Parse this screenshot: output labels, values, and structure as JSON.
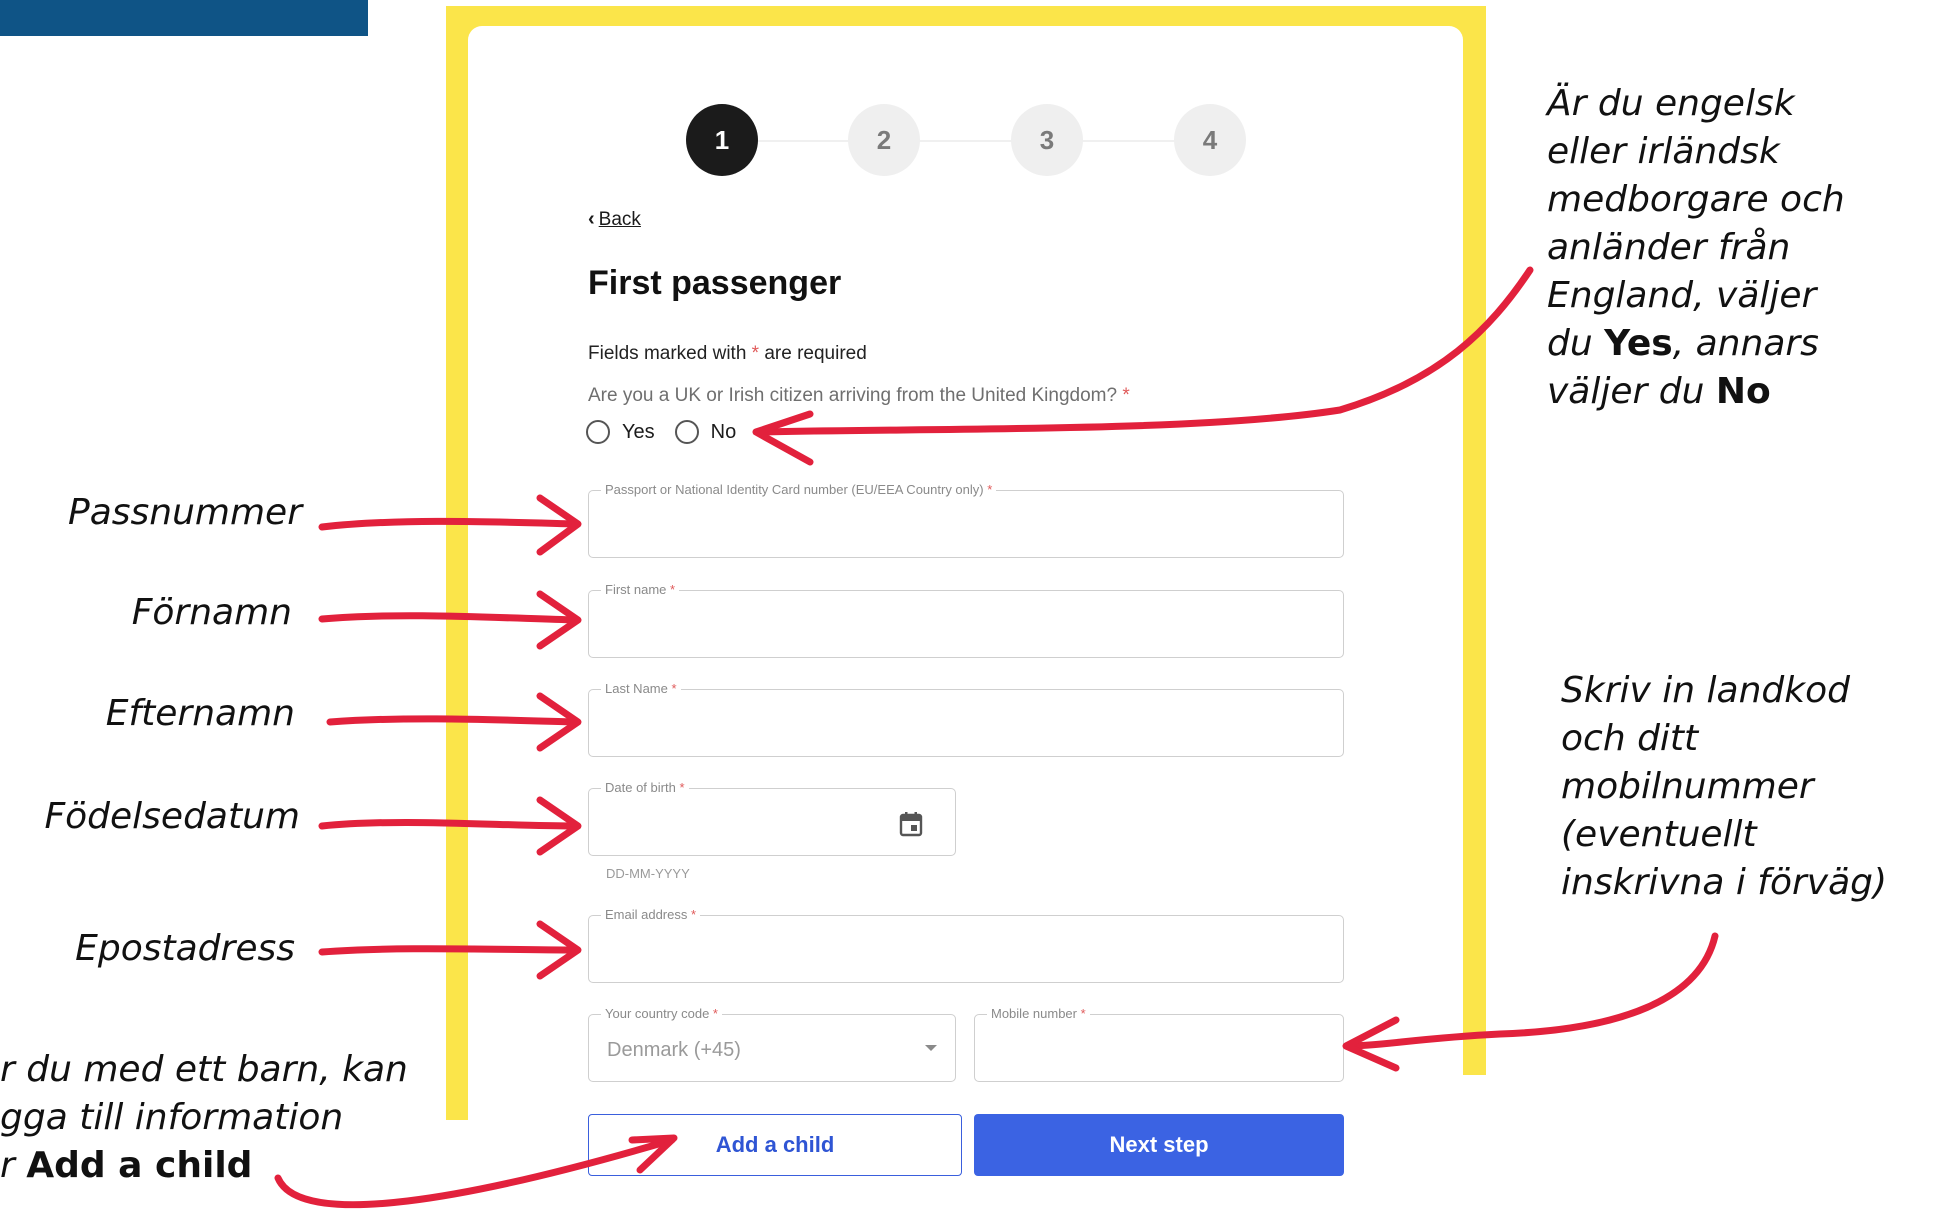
{
  "stepper": {
    "steps": [
      "1",
      "2",
      "3",
      "4"
    ],
    "active": 1
  },
  "back_label": "Back",
  "page_title": "First passenger",
  "required_note": {
    "before": "Fields marked with ",
    "star": "*",
    "after": " are required"
  },
  "question": {
    "text": "Are you a UK or Irish citizen arriving from the United Kingdom?",
    "star": " *"
  },
  "options": {
    "yes": "Yes",
    "no": "No"
  },
  "fields": {
    "passport": {
      "label": "Passport or National Identity Card number (EU/EEA Country only)",
      "star": " *",
      "value": ""
    },
    "first_name": {
      "label": "First name",
      "star": " *",
      "value": ""
    },
    "last_name": {
      "label": "Last Name",
      "star": " *",
      "value": ""
    },
    "dob": {
      "label": "Date of birth",
      "star": " *",
      "value": "",
      "helper": "DD-MM-YYYY"
    },
    "email": {
      "label": "Email address",
      "star": " *",
      "value": ""
    },
    "country_code": {
      "label": "Your country code",
      "star": " *",
      "value": "Denmark (+45)"
    },
    "mobile": {
      "label": "Mobile number",
      "star": " *",
      "value": ""
    }
  },
  "buttons": {
    "add_child": "Add a child",
    "next_step": "Next step"
  },
  "annotations": {
    "passnummer": "Passnummer",
    "fornamn": "Förnamn",
    "efternamn": "Efternamn",
    "fodelsedatum": "Födelsedatum",
    "epostadress": "Epostadress",
    "child_line1": "r du med ett barn, kan",
    "child_line2": "gga till information",
    "child_line3_pre": "r ",
    "child_line3_bold": "Add a child",
    "citizen_line1": "Är du engelsk",
    "citizen_line2": "eller irländsk",
    "citizen_line3": "medborgare och",
    "citizen_line4": "anländer från",
    "citizen_line5": "England, väljer",
    "citizen_line6_pre": "du ",
    "citizen_line6_bold": "Yes",
    "citizen_line6_post": ", annars",
    "citizen_line7_pre": "väljer du ",
    "citizen_line7_bold": "No",
    "mobile_line1": "Skriv in landkod",
    "mobile_line2": "och ditt",
    "mobile_line3": "mobilnummer",
    "mobile_line4": "(eventuellt",
    "mobile_line5": "inskrivna i förväg)"
  },
  "colors": {
    "frame": "#fbe54a",
    "top_bar": "#0f5486",
    "primary": "#3b63e3",
    "arrow": "#e2213c",
    "required": "#e05a5a"
  }
}
